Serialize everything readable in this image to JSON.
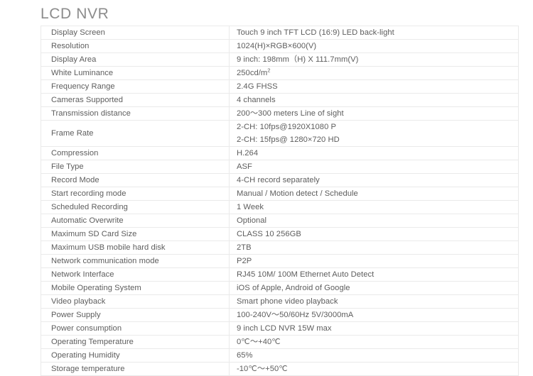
{
  "title": "LCD NVR",
  "table": {
    "rows": [
      {
        "label": "Display Screen",
        "value": "Touch 9 inch TFT LCD (16:9) LED back-light"
      },
      {
        "label": "Resolution",
        "value": "1024(H)×RGB×600(V)"
      },
      {
        "label": "Display Area",
        "value": "9 inch: 198mm（H) X 111.7mm(V)"
      },
      {
        "label": "White Luminance",
        "value": "250cd/m²"
      },
      {
        "label": "Frequency Range",
        "value": "2.4G FHSS"
      },
      {
        "label": "Cameras Supported",
        "value": "4 channels"
      },
      {
        "label": "Transmission distance",
        "value": "200～300 meters Line of sight"
      },
      {
        "label": "Frame Rate",
        "value": "2-CH: 10fps@1920X1080 P",
        "value2": "2-CH: 15fps@ 1280×720 HD"
      },
      {
        "label": "Compression",
        "value": "H.264"
      },
      {
        "label": "File Type",
        "value": "ASF"
      },
      {
        "label": "Record Mode",
        "value": "4-CH record separately"
      },
      {
        "label": "Start recording mode",
        "value": "Manual / Motion detect / Schedule"
      },
      {
        "label": "Scheduled Recording",
        "value": "1 Week"
      },
      {
        "label": "Automatic Overwrite",
        "value": "Optional"
      },
      {
        "label": "Maximum SD Card Size",
        "value": "CLASS 10  256GB"
      },
      {
        "label": "Maximum USB mobile hard disk",
        "value": "2TB"
      },
      {
        "label": "Network communication mode",
        "value": "P2P"
      },
      {
        "label": "Network Interface",
        "value": "RJ45 10M/ 100M Ethernet Auto Detect"
      },
      {
        "label": "Mobile Operating System",
        "value": "iOS of Apple, Android of Google"
      },
      {
        "label": "Video playback",
        "value": "Smart phone video playback"
      },
      {
        "label": "Power Supply",
        "value": "100-240V～50/60Hz 5V/3000mA"
      },
      {
        "label": "Power consumption",
        "value": "9 inch LCD NVR 15W max"
      },
      {
        "label": "Operating Temperature",
        "value": "0℃～+40℃"
      },
      {
        "label": "Operating Humidity",
        "value": "65%"
      },
      {
        "label": "Storage temperature",
        "value": "-10℃～+50℃"
      }
    ]
  },
  "colors": {
    "text": "#5d5d5d",
    "title": "#8c8c8c",
    "border": "#eaeaea",
    "background": "#ffffff"
  }
}
